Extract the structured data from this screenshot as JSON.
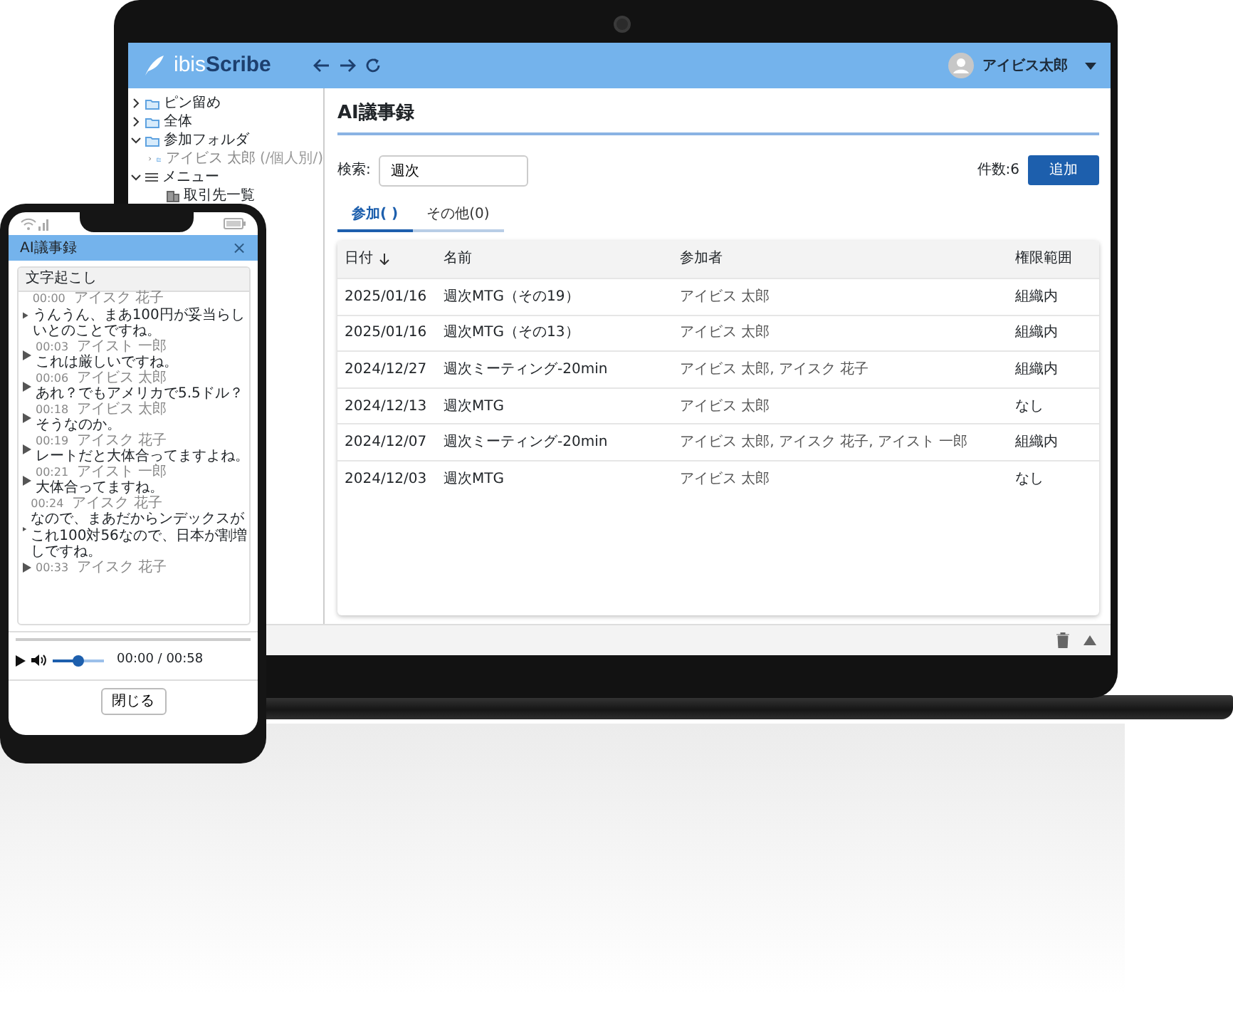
{
  "laptop": {
    "header": {
      "logo_light": "ibis",
      "logo_bold": "Scribe",
      "user": "アイビス太郎"
    },
    "sidebar": {
      "items": [
        {
          "label": "ピン留め",
          "kind": "folder",
          "expanded": false
        },
        {
          "label": "全体",
          "kind": "folder",
          "expanded": false
        },
        {
          "label": "参加フォルダ",
          "kind": "folder",
          "expanded": true,
          "children": [
            {
              "label": "アイビス 太郎",
              "note": "(/個人別/)",
              "kind": "folder",
              "expanded": false
            }
          ]
        },
        {
          "label": "メニュー",
          "kind": "menu",
          "expanded": true,
          "children": [
            {
              "label": "取引先一覧",
              "kind": "page"
            }
          ]
        }
      ]
    },
    "page": {
      "title": "AI議事録",
      "search": {
        "label": "検索:",
        "value": "週次"
      },
      "count": "件数:6",
      "add_button": "追加",
      "tabs": [
        {
          "label": "参加( )",
          "selected": true
        },
        {
          "label": "その他(0)",
          "selected": false
        }
      ],
      "table": {
        "columns": [
          {
            "label": "日付",
            "sorted": true
          },
          {
            "label": "名前",
            "sorted": false
          },
          {
            "label": "参加者",
            "sorted": false
          },
          {
            "label": "権限範囲",
            "sorted": false
          }
        ],
        "rows": [
          [
            "2025/01/16",
            "週次MTG（その19）",
            "アイビス 太郎",
            "組織内"
          ],
          [
            "2025/01/16",
            "週次MTG（その13）",
            "アイビス 太郎",
            "組織内"
          ],
          [
            "2024/12/27",
            "週次ミーティング-20min",
            "アイビス 太郎, アイスク 花子",
            "組織内"
          ],
          [
            "2024/12/13",
            "週次MTG",
            "アイビス 太郎",
            "なし"
          ],
          [
            "2024/12/07",
            "週次ミーティング-20min",
            "アイビス 太郎, アイスク 花子, アイスト 一郎",
            "組織内"
          ],
          [
            "2024/12/03",
            "週次MTG",
            "アイビス 太郎",
            "なし"
          ]
        ]
      }
    }
  },
  "phone": {
    "title": "AI議事録",
    "close_icon": "×",
    "card_title": "文字起こし",
    "entries": [
      {
        "time": "00:00",
        "speaker": "アイスク 花子",
        "text": "うんうん、まあ100円が妥当らしいとのことですね。"
      },
      {
        "time": "00:03",
        "speaker": "アイスト 一郎",
        "text": "これは厳しいですね。"
      },
      {
        "time": "00:06",
        "speaker": "アイビス 太郎",
        "text": "あれ？でもアメリカで5.5ドル？"
      },
      {
        "time": "00:18",
        "speaker": "アイビス 太郎",
        "text": "そうなのか。"
      },
      {
        "time": "00:19",
        "speaker": "アイスク 花子",
        "text": "レートだと大体合ってますよね。"
      },
      {
        "time": "00:21",
        "speaker": "アイスト 一郎",
        "text": "大体合ってますね。"
      },
      {
        "time": "00:24",
        "speaker": "アイスク 花子",
        "text": "なので、まあだからンデックスがこれ100対56なので、日本が割増しですね。"
      },
      {
        "time": "00:33",
        "speaker": "アイスク 花子"
      }
    ],
    "player": {
      "level": 0,
      "volume": {
        "level": 0.5
      },
      "time": "00:00 / 00:58"
    },
    "close_button": "閉じる"
  }
}
